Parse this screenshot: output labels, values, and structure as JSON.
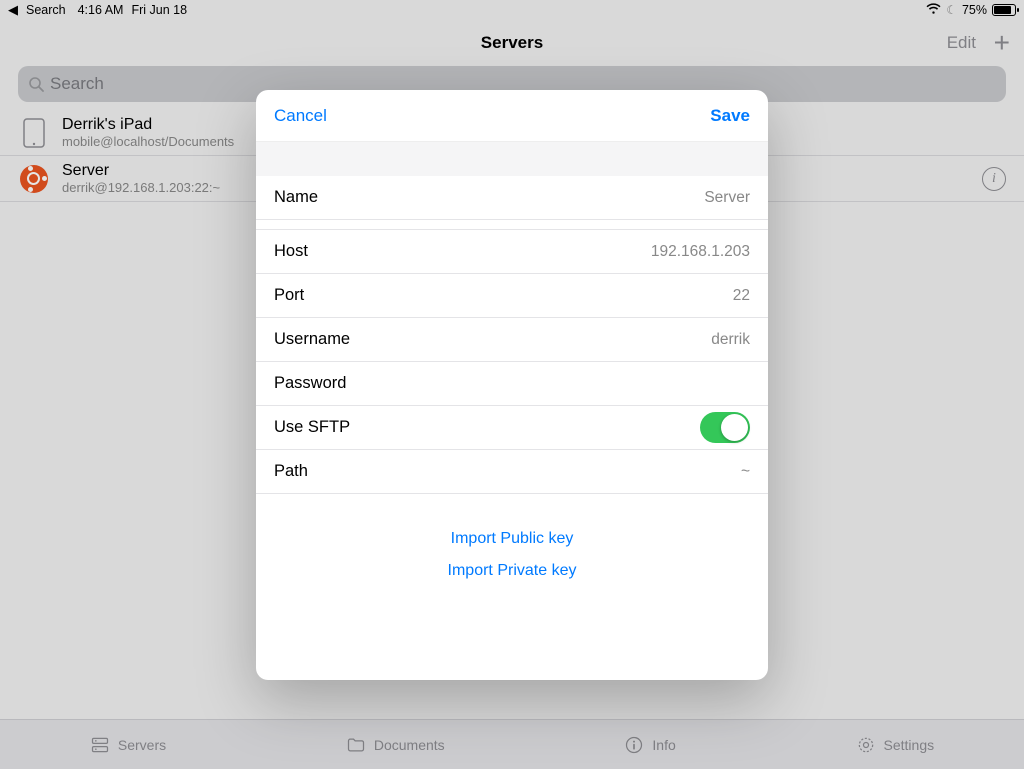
{
  "status": {
    "back_app": "Search",
    "time": "4:16 AM",
    "date": "Fri Jun 18",
    "battery_pct": "75%"
  },
  "header": {
    "title": "Servers",
    "edit": "Edit"
  },
  "search": {
    "placeholder": "Search"
  },
  "servers": [
    {
      "title": "Derrik's iPad",
      "subtitle": "mobile@localhost/Documents",
      "icon": "ipad"
    },
    {
      "title": "Server",
      "subtitle": "derrik@192.168.1.203:22:~",
      "icon": "ubuntu",
      "has_info": true
    }
  ],
  "modal": {
    "cancel": "Cancel",
    "save": "Save",
    "fields": {
      "name": {
        "label": "Name",
        "value": "Server"
      },
      "host": {
        "label": "Host",
        "value": "192.168.1.203"
      },
      "port": {
        "label": "Port",
        "value": "22"
      },
      "username": {
        "label": "Username",
        "value": "derrik"
      },
      "password": {
        "label": "Password",
        "value": ""
      },
      "sftp": {
        "label": "Use SFTP",
        "on": true
      },
      "path": {
        "label": "Path",
        "value": "~"
      }
    },
    "import_public": "Import Public key",
    "import_private": "Import Private key"
  },
  "tabs": {
    "servers": "Servers",
    "documents": "Documents",
    "info": "Info",
    "settings": "Settings"
  }
}
